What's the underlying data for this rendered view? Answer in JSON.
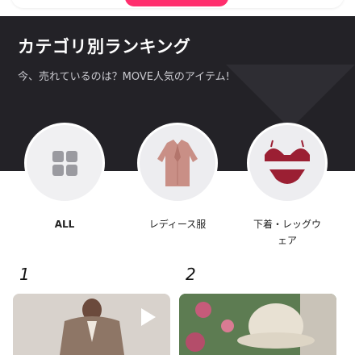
{
  "header": {
    "title": "カテゴリ別ランキング",
    "subtitle": "今、売れているのは？MOVE人気のアイテム!"
  },
  "categories": [
    {
      "label": "ALL",
      "icon": "grid-icon"
    },
    {
      "label": "レディース服",
      "icon": "blouse-image"
    },
    {
      "label": "下着・レッグウェア",
      "label_lines": [
        "下着・レッグウ",
        "ェア"
      ],
      "icon": "lingerie-image"
    }
  ],
  "ranking": [
    {
      "rank": "1",
      "media": "video",
      "icon": "play-icon"
    },
    {
      "rank": "2",
      "media": "image"
    }
  ],
  "colors": {
    "hero_bg": "#232227",
    "accent": "#ff2e6d",
    "blouse": "#c98f86",
    "lingerie": "#9b1f33"
  }
}
